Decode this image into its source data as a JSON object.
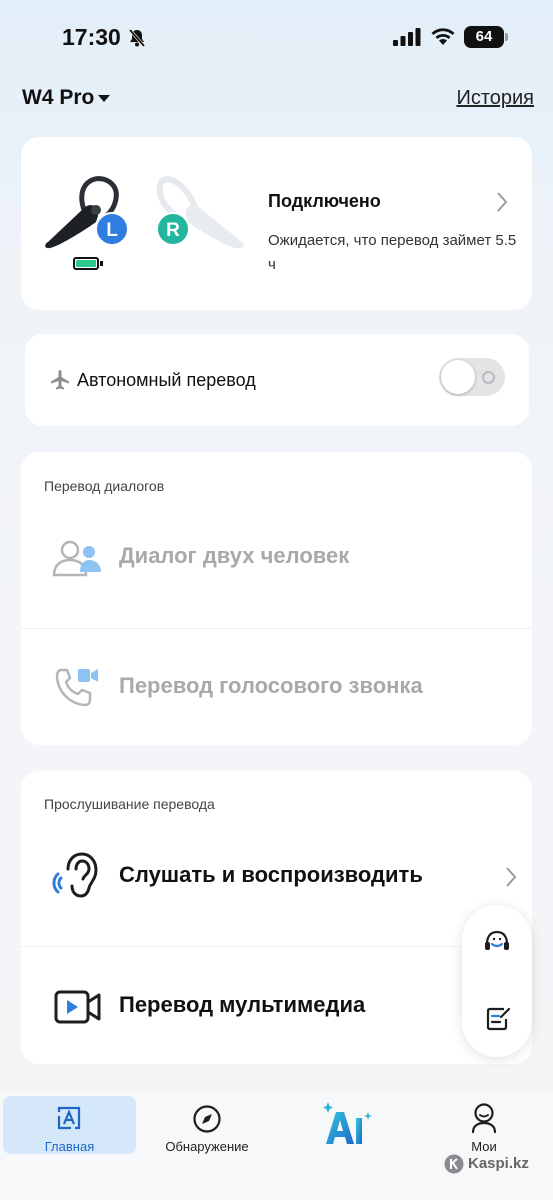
{
  "status_bar": {
    "time": "17:30",
    "battery": "64"
  },
  "header": {
    "device_name": "W4 Pro",
    "history_link": "История"
  },
  "device": {
    "left_label": "L",
    "right_label": "R",
    "status": "Подключено",
    "estimate": "Ожидается, что перевод займет 5.5 ч"
  },
  "offline": {
    "label": "Автономный перевод",
    "enabled": false
  },
  "dialog_section": {
    "title": "Перевод диалогов",
    "items": [
      {
        "label": "Диалог двух человек",
        "icon": "two-people-icon"
      },
      {
        "label": "Перевод голосового звонка",
        "icon": "video-call-icon"
      }
    ]
  },
  "listen_section": {
    "title": "Прослушивание перевода",
    "items": [
      {
        "label": "Слушать и воспроизводить",
        "icon": "ear-icon"
      },
      {
        "label": "Перевод мультимедиа",
        "icon": "video-play-icon"
      }
    ]
  },
  "floating": {
    "icons": [
      "headset-support-icon",
      "note-edit-icon"
    ]
  },
  "tabbar": {
    "tabs": [
      {
        "label": "Главная",
        "icon": "translate-icon",
        "active": true
      },
      {
        "label": "Обнаружение",
        "icon": "compass-icon",
        "active": false
      },
      {
        "label": "AI",
        "icon": "ai-sparkle-icon",
        "active": false
      },
      {
        "label": "Мои",
        "icon": "profile-icon",
        "active": false
      }
    ]
  },
  "watermark": "Kaspi.kz",
  "colors": {
    "accent": "#1f67c5",
    "left_badge": "#2f7dde",
    "right_badge": "#22b69e",
    "battery_fill": "#2cc98f"
  }
}
